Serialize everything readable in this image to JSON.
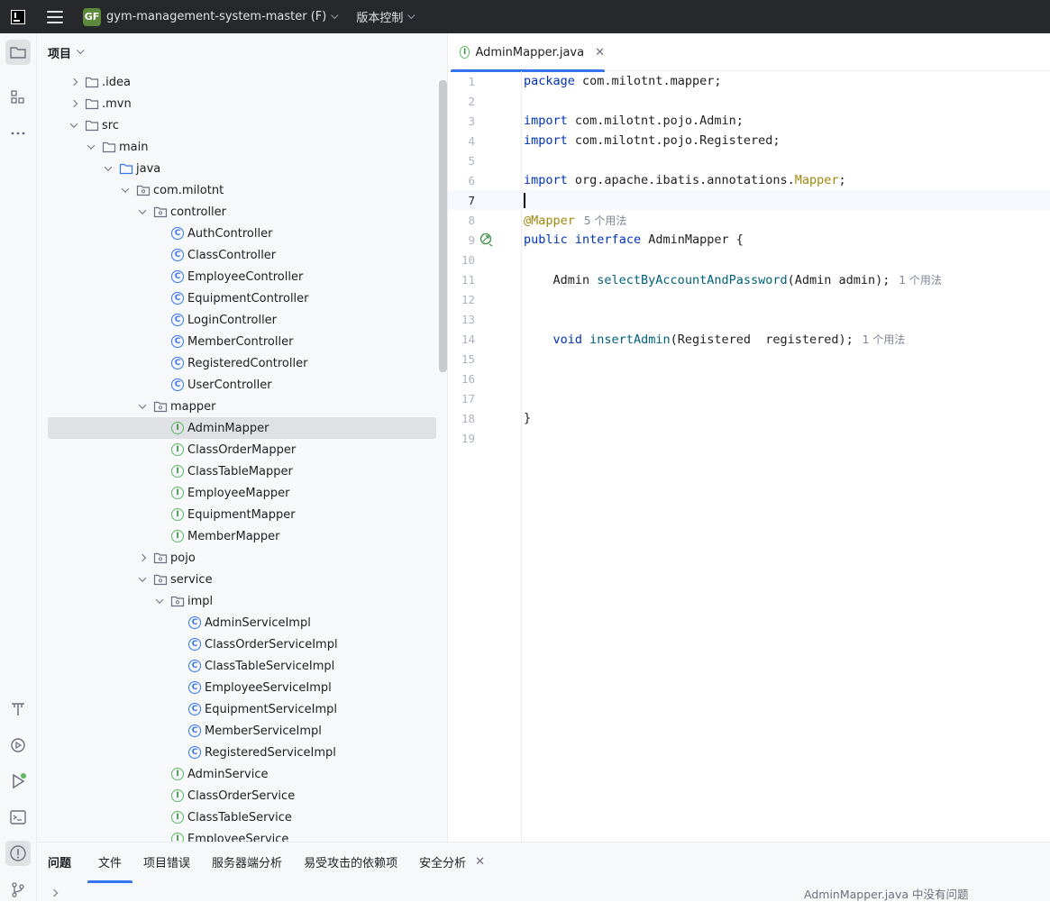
{
  "titlebar": {
    "project_badge": "GF",
    "project_name": "gym-management-system-master (F)",
    "vcs_label": "版本控制"
  },
  "project_panel": {
    "title": "项目",
    "tree": [
      {
        "label": ".idea",
        "depth": 0,
        "arrow": "right",
        "icon": "folder-icon"
      },
      {
        "label": ".mvn",
        "depth": 0,
        "arrow": "right",
        "icon": "folder-icon"
      },
      {
        "label": "src",
        "depth": 0,
        "arrow": "down",
        "icon": "folder-icon"
      },
      {
        "label": "main",
        "depth": 1,
        "arrow": "down",
        "icon": "folder-icon"
      },
      {
        "label": "java",
        "depth": 2,
        "arrow": "down",
        "icon": "source-folder-icon"
      },
      {
        "label": "com.milotnt",
        "depth": 3,
        "arrow": "down",
        "icon": "package-icon"
      },
      {
        "label": "controller",
        "depth": 4,
        "arrow": "down",
        "icon": "package-icon"
      },
      {
        "label": "AuthController",
        "depth": 5,
        "arrow": "none",
        "icon": "class-icon"
      },
      {
        "label": "ClassController",
        "depth": 5,
        "arrow": "none",
        "icon": "class-icon"
      },
      {
        "label": "EmployeeController",
        "depth": 5,
        "arrow": "none",
        "icon": "class-icon"
      },
      {
        "label": "EquipmentController",
        "depth": 5,
        "arrow": "none",
        "icon": "class-icon"
      },
      {
        "label": "LoginController",
        "depth": 5,
        "arrow": "none",
        "icon": "class-icon"
      },
      {
        "label": "MemberController",
        "depth": 5,
        "arrow": "none",
        "icon": "class-icon"
      },
      {
        "label": "RegisteredController",
        "depth": 5,
        "arrow": "none",
        "icon": "class-icon"
      },
      {
        "label": "UserController",
        "depth": 5,
        "arrow": "none",
        "icon": "class-icon"
      },
      {
        "label": "mapper",
        "depth": 4,
        "arrow": "down",
        "icon": "package-icon"
      },
      {
        "label": "AdminMapper",
        "depth": 5,
        "arrow": "none",
        "icon": "interface-icon",
        "selected": true
      },
      {
        "label": "ClassOrderMapper",
        "depth": 5,
        "arrow": "none",
        "icon": "interface-icon"
      },
      {
        "label": "ClassTableMapper",
        "depth": 5,
        "arrow": "none",
        "icon": "interface-icon"
      },
      {
        "label": "EmployeeMapper",
        "depth": 5,
        "arrow": "none",
        "icon": "interface-icon"
      },
      {
        "label": "EquipmentMapper",
        "depth": 5,
        "arrow": "none",
        "icon": "interface-icon"
      },
      {
        "label": "MemberMapper",
        "depth": 5,
        "arrow": "none",
        "icon": "interface-icon"
      },
      {
        "label": "pojo",
        "depth": 4,
        "arrow": "right",
        "icon": "package-icon"
      },
      {
        "label": "service",
        "depth": 4,
        "arrow": "down",
        "icon": "package-icon"
      },
      {
        "label": "impl",
        "depth": 5,
        "arrow": "down",
        "icon": "package-icon"
      },
      {
        "label": "AdminServiceImpl",
        "depth": 6,
        "arrow": "none",
        "icon": "class-icon"
      },
      {
        "label": "ClassOrderServiceImpl",
        "depth": 6,
        "arrow": "none",
        "icon": "class-icon"
      },
      {
        "label": "ClassTableServiceImpl",
        "depth": 6,
        "arrow": "none",
        "icon": "class-icon"
      },
      {
        "label": "EmployeeServiceImpl",
        "depth": 6,
        "arrow": "none",
        "icon": "class-icon"
      },
      {
        "label": "EquipmentServiceImpl",
        "depth": 6,
        "arrow": "none",
        "icon": "class-icon"
      },
      {
        "label": "MemberServiceImpl",
        "depth": 6,
        "arrow": "none",
        "icon": "class-icon"
      },
      {
        "label": "RegisteredServiceImpl",
        "depth": 6,
        "arrow": "none",
        "icon": "class-icon"
      },
      {
        "label": "AdminService",
        "depth": 5,
        "arrow": "none",
        "icon": "interface-icon"
      },
      {
        "label": "ClassOrderService",
        "depth": 5,
        "arrow": "none",
        "icon": "interface-icon"
      },
      {
        "label": "ClassTableService",
        "depth": 5,
        "arrow": "none",
        "icon": "interface-icon"
      },
      {
        "label": "EmployeeService",
        "depth": 5,
        "arrow": "none",
        "icon": "interface-icon"
      }
    ]
  },
  "editor": {
    "tab_label": "AdminMapper.java",
    "current_line": 7,
    "lines": [
      {
        "n": "1",
        "tokens": [
          {
            "t": "package",
            "c": "kw"
          },
          {
            "t": " com.milotnt.mapper;",
            "c": ""
          }
        ]
      },
      {
        "n": "2",
        "tokens": []
      },
      {
        "n": "3",
        "tokens": [
          {
            "t": "import",
            "c": "kw"
          },
          {
            "t": " com.milotnt.pojo.Admin;",
            "c": ""
          }
        ]
      },
      {
        "n": "4",
        "tokens": [
          {
            "t": "import",
            "c": "kw"
          },
          {
            "t": " com.milotnt.pojo.Registered;",
            "c": ""
          }
        ]
      },
      {
        "n": "5",
        "tokens": []
      },
      {
        "n": "6",
        "tokens": [
          {
            "t": "import",
            "c": "kw"
          },
          {
            "t": " org.apache.ibatis.annotations.",
            "c": ""
          },
          {
            "t": "Mapper",
            "c": "ann"
          },
          {
            "t": ";",
            "c": ""
          }
        ]
      },
      {
        "n": "7",
        "tokens": [],
        "caret": true
      },
      {
        "n": "8",
        "tokens": [
          {
            "t": "@Mapper",
            "c": "ann"
          }
        ],
        "hint": "5 个用法"
      },
      {
        "n": "9",
        "tokens": [
          {
            "t": "public",
            "c": "kw"
          },
          {
            "t": " ",
            "c": ""
          },
          {
            "t": "interface",
            "c": "kw"
          },
          {
            "t": " AdminMapper {",
            "c": ""
          }
        ],
        "gutter_icon": "implemented-icon"
      },
      {
        "n": "10",
        "tokens": []
      },
      {
        "n": "11",
        "tokens": [
          {
            "t": "    Admin ",
            "c": ""
          },
          {
            "t": "selectByAccountAndPassword",
            "c": "fn"
          },
          {
            "t": "(Admin admin);",
            "c": ""
          }
        ],
        "hint": "1 个用法"
      },
      {
        "n": "12",
        "tokens": []
      },
      {
        "n": "13",
        "tokens": []
      },
      {
        "n": "14",
        "tokens": [
          {
            "t": "    ",
            "c": ""
          },
          {
            "t": "void",
            "c": "kw"
          },
          {
            "t": " ",
            "c": ""
          },
          {
            "t": "insertAdmin",
            "c": "fn"
          },
          {
            "t": "(Registered  registered);",
            "c": ""
          }
        ],
        "hint": "1 个用法"
      },
      {
        "n": "15",
        "tokens": []
      },
      {
        "n": "16",
        "tokens": []
      },
      {
        "n": "17",
        "tokens": []
      },
      {
        "n": "18",
        "tokens": [
          {
            "t": "}",
            "c": ""
          }
        ]
      },
      {
        "n": "19",
        "tokens": []
      }
    ]
  },
  "bottom": {
    "title": "问题",
    "tabs": [
      "文件",
      "项目错误",
      "服务器端分析",
      "易受攻击的依赖项",
      "安全分析"
    ],
    "active_tab": "文件",
    "status_message": "AdminMapper.java 中没有问题"
  },
  "colors": {
    "accent": "#3574f0",
    "keyword": "#0033b3",
    "annotation": "#9e880d",
    "method": "#00627a",
    "titlebar_bg": "#27282c",
    "panel_bg": "#f7f8fa"
  }
}
